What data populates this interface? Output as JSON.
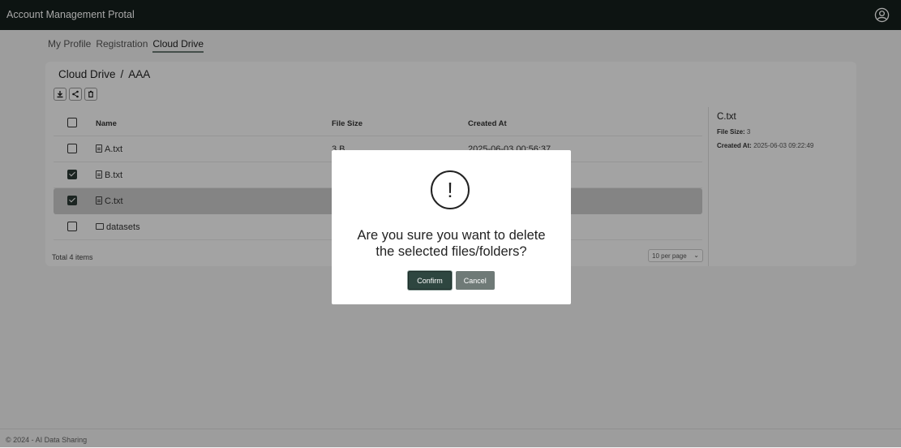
{
  "app": {
    "title": "Account Management Protal"
  },
  "nav": {
    "items": [
      "My Profile",
      "Registration",
      "Cloud Drive"
    ],
    "active": "Cloud Drive"
  },
  "breadcrumb": {
    "root": "Cloud Drive",
    "separator": "/",
    "current": "AAA"
  },
  "toolbar": {
    "icons": [
      "download-icon",
      "share-icon",
      "trash-icon"
    ]
  },
  "table": {
    "headers": {
      "name": "Name",
      "size": "File Size",
      "created": "Created At"
    },
    "rows": [
      {
        "name": "A.txt",
        "type": "file",
        "size": "3 B",
        "created": "2025-06-03 00:56:37",
        "checked": false
      },
      {
        "name": "B.txt",
        "type": "file",
        "size": "",
        "created": "",
        "checked": true
      },
      {
        "name": "C.txt",
        "type": "file",
        "size": "",
        "created": "",
        "checked": true
      },
      {
        "name": "datasets",
        "type": "folder",
        "size": "",
        "created": "",
        "checked": false
      }
    ],
    "total": "Total 4 items",
    "per_page": "10 per page"
  },
  "detail": {
    "name": "C.txt",
    "size_label": "File Size:",
    "size_value": "3",
    "created_label": "Created At:",
    "created_value": "2025-06-03 09:22:49"
  },
  "modal": {
    "icon": "!",
    "message_line1": "Are you sure you want to delete",
    "message_line2": "the selected files/folders?",
    "confirm": "Confirm",
    "cancel": "Cancel"
  },
  "footer": {
    "text": "© 2024 - AI Data Sharing"
  },
  "colors": {
    "topbar": "#151f1c",
    "primary": "#2e4640",
    "secondary": "#6f7a77"
  }
}
